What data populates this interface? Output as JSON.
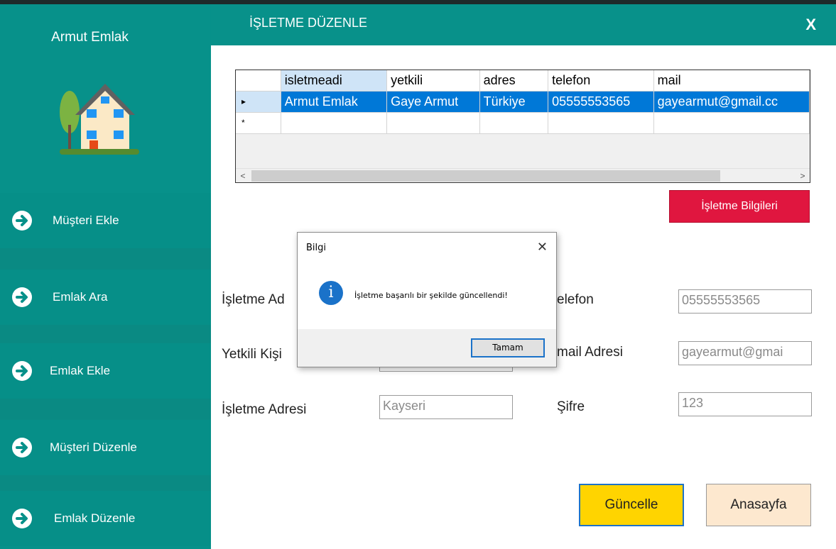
{
  "sidebar": {
    "brand": "Armut Emlak",
    "items": [
      {
        "label": "Müşteri Ekle"
      },
      {
        "label": "Emlak Ara"
      },
      {
        "label": "Emlak Ekle"
      },
      {
        "label": "Müşteri Düzenle"
      },
      {
        "label": "Emlak Düzenle"
      }
    ]
  },
  "header": {
    "title": "İŞLETME DÜZENLE",
    "close": "X"
  },
  "grid": {
    "columns": [
      "isletmeadi",
      "yetkili",
      "adres",
      "telefon",
      "mail"
    ],
    "rows": [
      [
        "Armut Emlak",
        "Gaye Armut",
        "Türkiye",
        "05555553565",
        "gayearmut@gmail.cc"
      ]
    ],
    "selected_marker": "▸",
    "new_row_marker": "*",
    "scroll_left": "<",
    "scroll_right": ">"
  },
  "buttons": {
    "info": "İşletme Bilgileri",
    "update": "Güncelle",
    "home": "Anasayfa"
  },
  "form": {
    "labels": {
      "business_name": "İşletme Ad",
      "contact_person": "Yetkili Kişi",
      "address": "İşletme Adresi",
      "phone": "elefon",
      "email": "mail Adresi",
      "password": "Şifre"
    },
    "values": {
      "address": "Kayseri",
      "phone": "05555553565",
      "email": "gayearmut@gmai",
      "password": "123"
    }
  },
  "dialog": {
    "title": "Bilgi",
    "close": "✕",
    "icon": "i",
    "message": "İşletme başarılı bir şekilde güncellendi!",
    "ok": "Tamam"
  },
  "colors": {
    "sidebar": "#07918a",
    "header": "#08918a",
    "info_button": "#e0163f",
    "update_button": "#ffd400",
    "home_button": "#fde8cf",
    "selection": "#0078d7"
  }
}
